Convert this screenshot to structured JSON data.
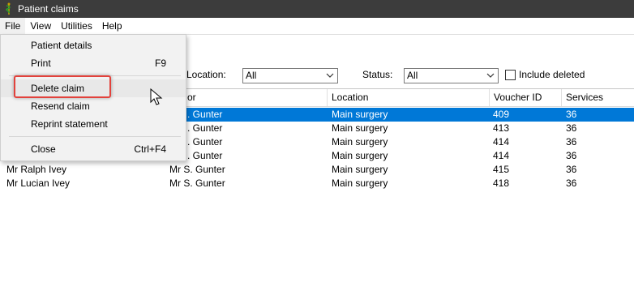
{
  "window": {
    "title": "Patient claims",
    "icon": "caduceus-icon"
  },
  "menubar": {
    "items": [
      "File",
      "View",
      "Utilities",
      "Help"
    ]
  },
  "file_menu": {
    "items": [
      {
        "label": "Patient details",
        "shortcut": ""
      },
      {
        "label": "Print",
        "shortcut": "F9"
      },
      {
        "label": "Delete claim",
        "shortcut": ""
      },
      {
        "label": "Resend claim",
        "shortcut": ""
      },
      {
        "label": "Reprint statement",
        "shortcut": ""
      },
      {
        "label": "Close",
        "shortcut": "Ctrl+F4"
      }
    ]
  },
  "filters": {
    "location_label": "Location:",
    "location_value": "All",
    "status_label": "Status:",
    "status_value": "All",
    "include_deleted_label": "Include deleted",
    "include_deleted_checked": false
  },
  "table": {
    "columns": [
      "or",
      "Location",
      "Voucher ID",
      "Services"
    ],
    "rows": [
      {
        "patient": "",
        "provider": ". Gunter",
        "location": "Main surgery",
        "voucher": "409",
        "services": "36",
        "selected": true
      },
      {
        "patient": "",
        "provider": ". Gunter",
        "location": "Main surgery",
        "voucher": "413",
        "services": "36",
        "selected": false
      },
      {
        "patient": "",
        "provider": ". Gunter",
        "location": "Main surgery",
        "voucher": "414",
        "services": "36",
        "selected": false
      },
      {
        "patient": "",
        "provider": ". Gunter",
        "location": "Main surgery",
        "voucher": "414",
        "services": "36",
        "selected": false
      },
      {
        "patient": "Mr Ralph Ivey",
        "provider": "Mr S. Gunter",
        "location": "Main surgery",
        "voucher": "415",
        "services": "36",
        "selected": false
      },
      {
        "patient": "Mr Lucian Ivey",
        "provider": "Mr S. Gunter",
        "location": "Main surgery",
        "voucher": "418",
        "services": "36",
        "selected": false
      }
    ]
  },
  "colors": {
    "selection": "#0078d7",
    "titlebar": "#3c3c3c",
    "highlight": "#e2423c"
  }
}
